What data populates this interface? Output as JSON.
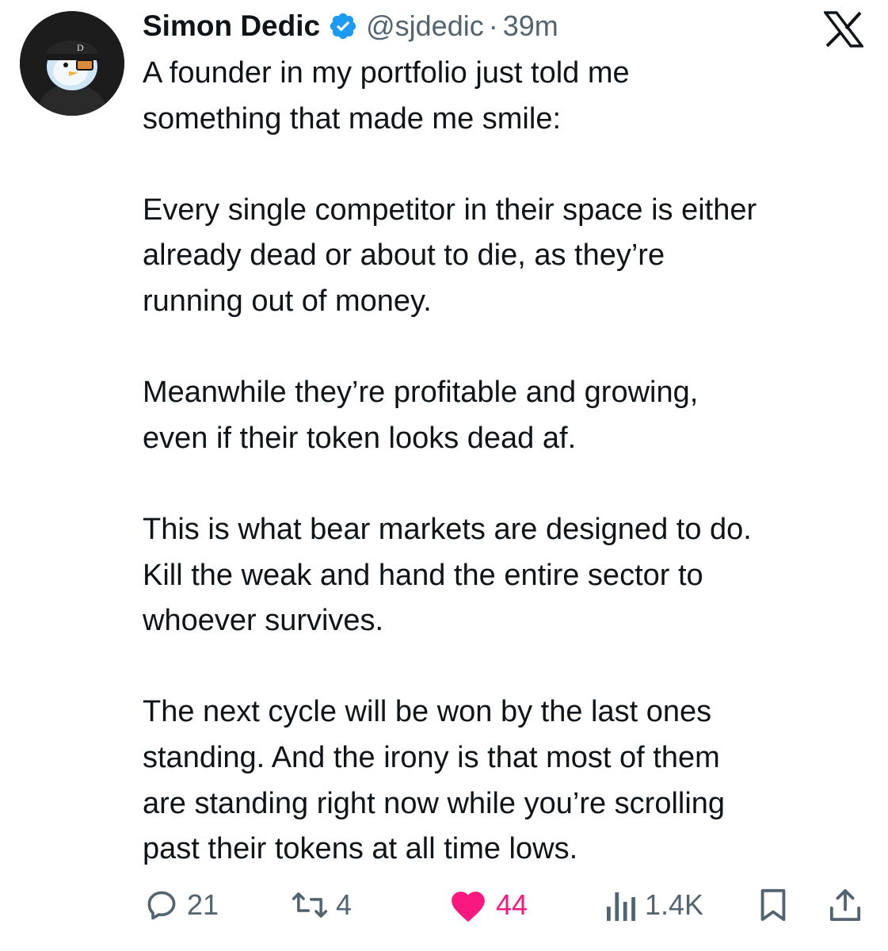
{
  "author": {
    "display_name": "Simon Dedic",
    "handle": "@sjdedic",
    "separator": "·",
    "time": "39m",
    "verified": true,
    "avatar_icon": "penguin-avatar-icon"
  },
  "platform_logo": "x-logo-icon",
  "tweet": {
    "paragraphs": [
      [
        "A founder in my portfolio just told me",
        "something that made me smile:"
      ],
      [
        "Every single competitor in their space is either",
        "already dead or about to die, as they’re",
        "running out of money."
      ],
      [
        "Meanwhile they’re profitable and growing,",
        "even if their token looks dead af."
      ],
      [
        "This is what bear markets are designed to do.",
        "Kill the weak and hand the entire sector to",
        "whoever survives."
      ],
      [
        "The next cycle will be won by the last ones",
        "standing. And the irony is that most of them",
        "are standing right now while you’re scrolling",
        "past their tokens at all time lows."
      ]
    ]
  },
  "actions": {
    "replies": "21",
    "reposts": "4",
    "likes": "44",
    "views": "1.4K",
    "liked": true
  },
  "colors": {
    "text": "#0f1419",
    "secondary": "#536471",
    "verified": "#1d9bf0",
    "like": "#f91880"
  }
}
